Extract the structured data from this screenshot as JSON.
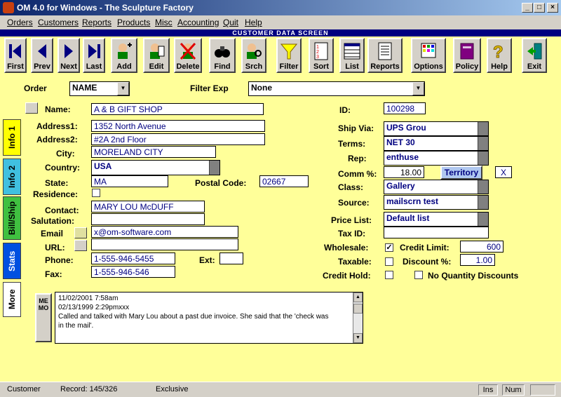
{
  "window": {
    "title": "OM 4.0 for Windows - The Sculpture Factory"
  },
  "menubar": [
    "Orders",
    "Customers",
    "Reports",
    "Products",
    "Misc",
    "Accounting",
    "Quit",
    "Help"
  ],
  "screen_title": "CUSTOMER DATA SCREEN",
  "toolbar": {
    "first": "First",
    "prev": "Prev",
    "next": "Next",
    "last": "Last",
    "add": "Add",
    "edit": "Edit",
    "delete": "Delete",
    "find": "Find",
    "srch": "Srch",
    "filter": "Filter",
    "sort": "Sort",
    "list": "List",
    "reports": "Reports",
    "options": "Options",
    "policy": "Policy",
    "help": "Help",
    "exit": "Exit"
  },
  "order": {
    "label": "Order",
    "value": "NAME"
  },
  "filter": {
    "label": "Filter Exp",
    "value": "None"
  },
  "tabs": {
    "info1": "Info 1",
    "info2": "Info 2",
    "billship": "Bill/Ship",
    "stats": "Stats",
    "more": "More"
  },
  "customer": {
    "name_label": "Name:",
    "name": "A & B GIFT SHOP",
    "address1_label": "Address1:",
    "address1": "1352 North Avenue",
    "address2_label": "Address2:",
    "address2": "#2A  2nd Floor",
    "city_label": "City:",
    "city": "MORELAND CITY",
    "country_label": "Country:",
    "country": "USA",
    "state_label": "State:",
    "state": "MA",
    "postal_label": "Postal Code:",
    "postal": "02667",
    "residence_label": "Residence:",
    "contact_label": "Contact:",
    "contact": "MARY LOU McDUFF",
    "salutation_label": "Salutation:",
    "salutation": "",
    "email_label": "Email",
    "email": "x@om-software.com",
    "url_label": "URL:",
    "url": "",
    "phone_label": "Phone:",
    "phone": "1-555-946-5455",
    "ext_label": "Ext:",
    "ext": "",
    "fax_label": "Fax:",
    "fax": "1-555-946-546"
  },
  "right": {
    "id_label": "ID:",
    "id": "100298",
    "shipvia_label": "Ship Via:",
    "shipvia": "UPS Grou",
    "terms_label": "Terms:",
    "terms": "NET 30",
    "rep_label": "Rep:",
    "rep": "enthuse",
    "comm_label": "Comm %:",
    "comm": "18.00",
    "territory_button": "Territory",
    "territory_value": "X",
    "class_label": "Class:",
    "class": "Gallery",
    "source_label": "Source:",
    "source": "mailscrn test",
    "pricelist_label": "Price List:",
    "pricelist": "Default list",
    "taxid_label": "Tax ID:",
    "taxid": "",
    "wholesale_label": "Wholesale:",
    "wholesale_checked": "✓",
    "creditlimit_label": "Credit Limit:",
    "creditlimit": "600",
    "taxable_label": "Taxable:",
    "discount_label": "Discount %:",
    "discount": "1.00",
    "credithold_label": "Credit Hold:",
    "noqty_label": "No Quantity Discounts"
  },
  "memo": {
    "button": "MEMO",
    "lines": [
      "11/02/2001   7:58am",
      "02/13/1999   2:29pmxxx",
      "Called and talked with Mary Lou about a past due invoice. She said that the 'check was",
      "in the mail'."
    ]
  },
  "status": {
    "module": "Customer",
    "record": "Record: 145/326",
    "mode": "Exclusive",
    "ins": "Ins",
    "num": "Num"
  }
}
